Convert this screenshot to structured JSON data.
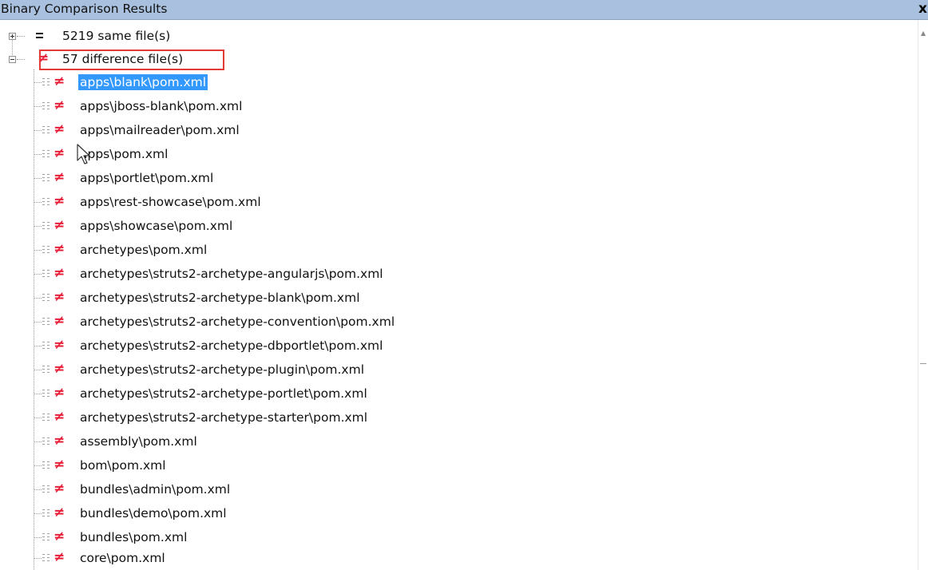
{
  "window": {
    "title": "Binary Comparison Results",
    "close_glyph": "x"
  },
  "groups": [
    {
      "label": "5219 same file(s)",
      "icon": "equals-icon",
      "expanded": false
    },
    {
      "label": "57 difference file(s)",
      "icon": "not-equal-icon",
      "expanded": true
    }
  ],
  "diff_files": [
    "apps\\blank\\pom.xml",
    "apps\\jboss-blank\\pom.xml",
    "apps\\mailreader\\pom.xml",
    "apps\\pom.xml",
    "apps\\portlet\\pom.xml",
    "apps\\rest-showcase\\pom.xml",
    "apps\\showcase\\pom.xml",
    "archetypes\\pom.xml",
    "archetypes\\struts2-archetype-angularjs\\pom.xml",
    "archetypes\\struts2-archetype-blank\\pom.xml",
    "archetypes\\struts2-archetype-convention\\pom.xml",
    "archetypes\\struts2-archetype-dbportlet\\pom.xml",
    "archetypes\\struts2-archetype-plugin\\pom.xml",
    "archetypes\\struts2-archetype-portlet\\pom.xml",
    "archetypes\\struts2-archetype-starter\\pom.xml",
    "assembly\\pom.xml",
    "bom\\pom.xml",
    "bundles\\admin\\pom.xml",
    "bundles\\demo\\pom.xml",
    "bundles\\pom.xml",
    "core\\pom.xml"
  ],
  "selected_file": "apps\\blank\\pom.xml",
  "colors": {
    "titlebar": "#a9c0de",
    "selection": "#3399ff",
    "diff_icon": "#e8203a",
    "highlight_box": "#e53935"
  }
}
